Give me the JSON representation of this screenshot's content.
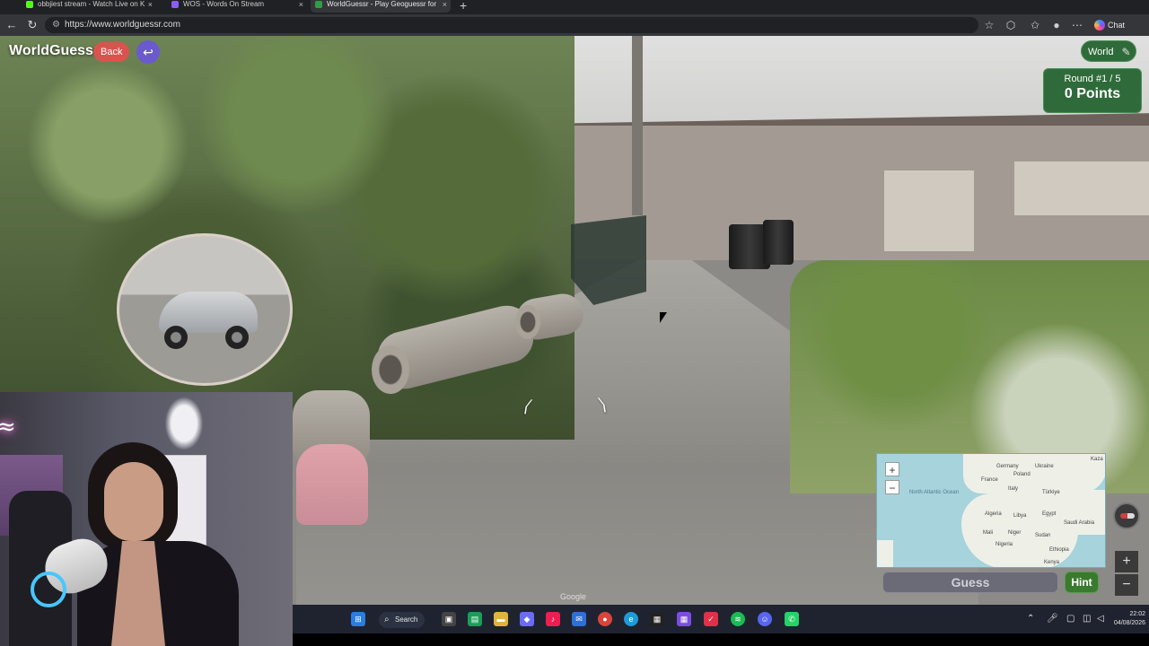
{
  "browser": {
    "tabs": [
      {
        "label": "obbjiest stream - Watch Live on K",
        "favicon_color": "#53fc18"
      },
      {
        "label": "WOS - Words On Stream",
        "favicon_color": "#8b5cf6"
      },
      {
        "label": "WorldGuessr - Play Geoguessr for",
        "favicon_color": "#2f9e44",
        "active": true
      }
    ],
    "url": "https://www.worldguessr.com",
    "chat_label": "Chat"
  },
  "game": {
    "logo": "WorldGuessr",
    "back_label": "Back",
    "return_icon": "return-arrow-icon",
    "mode_label": "World",
    "round_label": "Round #1 / 5",
    "points_label": "0 Points",
    "guess_label": "Guess",
    "hint_label": "Hint",
    "google_watermark": "Google",
    "zoom_in": "+",
    "zoom_out": "−",
    "map_labels": {
      "ocean": "North Atlantic Ocean",
      "countries": [
        "Germany",
        "Ukraine",
        "Kaza",
        "Poland",
        "France",
        "Italy",
        "Türkiye",
        "Algeria",
        "Libya",
        "Egypt",
        "Saudi Arabia",
        "Mali",
        "Niger",
        "Sudan",
        "Nigeria",
        "Ethiopia",
        "Kenya"
      ]
    }
  },
  "taskbar": {
    "search_label": "Search",
    "clock_time": "22:02",
    "clock_date": "04/08/2026",
    "apps": [
      "windows-start",
      "task-view",
      "store",
      "files",
      "copilot",
      "tiktok",
      "outlook",
      "chrome",
      "edge",
      "chill-brew",
      "calc-grid",
      "todo",
      "spotify",
      "discord",
      "whatsapp"
    ]
  },
  "colors": {
    "accent_green": "#2f6b3a",
    "back_red": "#d9534f",
    "return_purple": "#6a5acd",
    "guess_disabled": "#6b6b78",
    "hint_green": "#3a7a2f"
  }
}
